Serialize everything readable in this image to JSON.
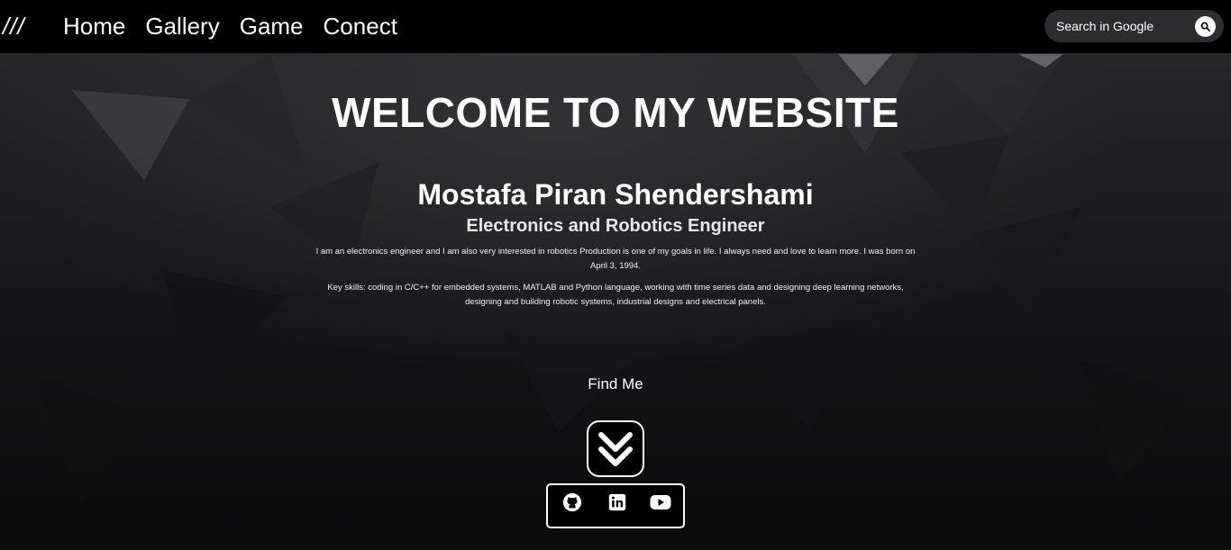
{
  "navbar": {
    "menu_label": "///",
    "links": [
      "Home",
      "Gallery",
      "Game",
      "Conect"
    ]
  },
  "search": {
    "placeholder": "Search in Google",
    "button_icon": "search-icon"
  },
  "hero": {
    "title": "WELCOME TO MY WEBSITE",
    "name": "Mostafa Piran Shendershami",
    "role": "Electronics and Robotics Engineer",
    "bio_paragraph_1": "I am an electronics engineer and I am also very interested in robotics Production is one of my goals in life. I always need and love to learn more. I was born on April 3, 1994.",
    "bio_paragraph_2": "Key skills: coding in C/C++ for embedded systems, MATLAB and Python language, working with time series data and designing deep learning networks, designing and building robotic systems, industrial designs and electrical panels."
  },
  "find_me": {
    "label": "Find Me",
    "scroll_icon": "double-chevron-down-icon",
    "social_icons": [
      "github-icon",
      "linkedin-icon",
      "youtube-icon"
    ]
  },
  "colors": {
    "navbar_bg": "#000000",
    "search_bg": "#2d2d2f",
    "text": "#ffffff",
    "page_bg": "#0b0b0c"
  }
}
